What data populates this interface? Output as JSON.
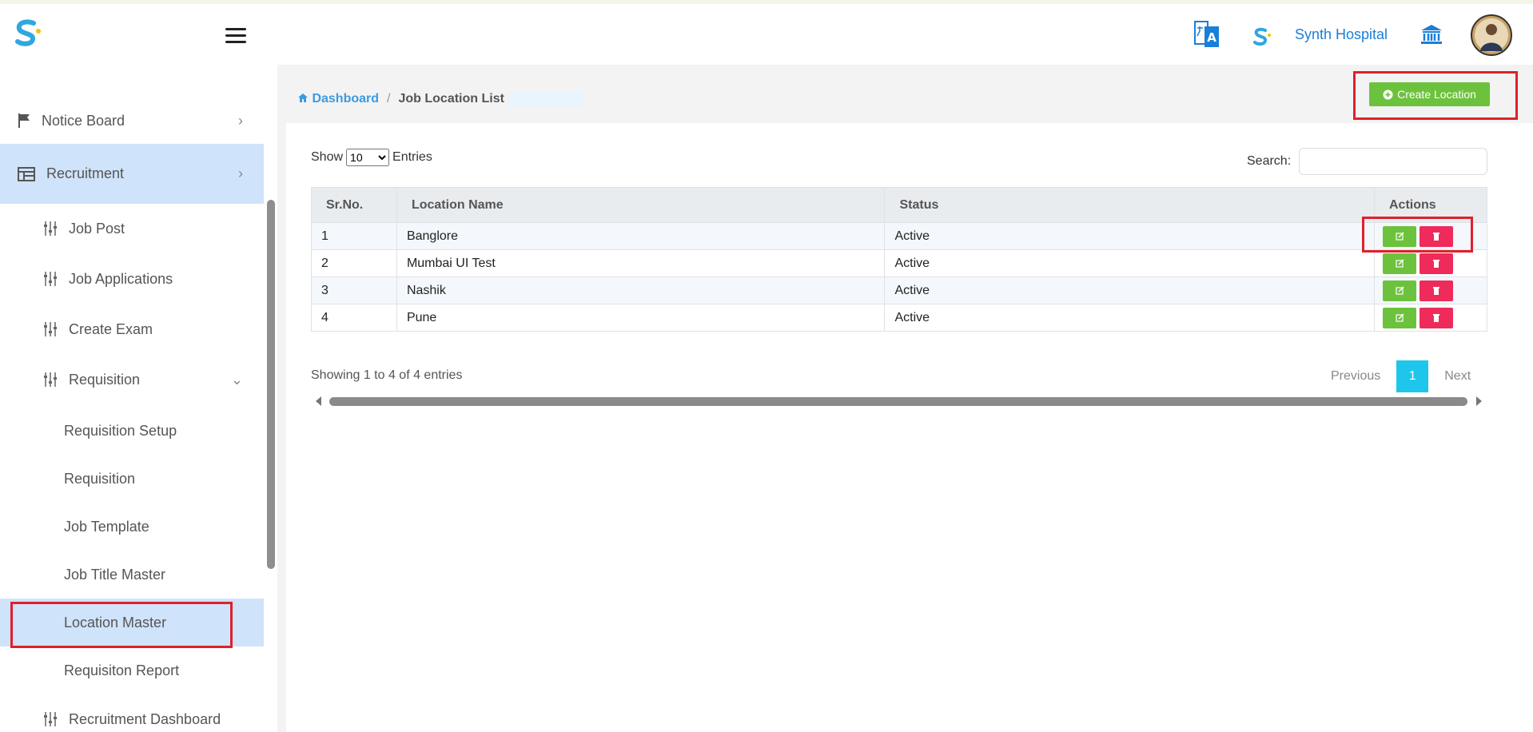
{
  "app": {
    "hospital_name": "Synth Hospital"
  },
  "sidebar": {
    "items": [
      {
        "label": "Notice Board"
      },
      {
        "label": "Recruitment"
      }
    ],
    "recruitment_items": [
      {
        "label": "Job Post"
      },
      {
        "label": "Job Applications"
      },
      {
        "label": "Create Exam"
      },
      {
        "label": "Requisition"
      }
    ],
    "requisition_items": [
      {
        "label": "Requisition Setup"
      },
      {
        "label": "Requisition"
      },
      {
        "label": "Job Template"
      },
      {
        "label": "Job Title Master"
      },
      {
        "label": "Location Master"
      },
      {
        "label": "Requisiton Report"
      }
    ],
    "recruitment_dashboard": "Recruitment Dashboard"
  },
  "breadcrumb": {
    "home": "Dashboard",
    "current": "Job Location List"
  },
  "toolbar": {
    "create_label": "Create Location"
  },
  "list": {
    "show_label": "Show",
    "entries_label": "Entries",
    "page_size": "10",
    "search_label": "Search:",
    "columns": [
      "Sr.No.",
      "Location Name",
      "Status",
      "Actions"
    ],
    "rows": [
      {
        "sr": "1",
        "name": "Banglore",
        "status": "Active"
      },
      {
        "sr": "2",
        "name": "Mumbai UI Test",
        "status": "Active"
      },
      {
        "sr": "3",
        "name": "Nashik",
        "status": "Active"
      },
      {
        "sr": "4",
        "name": "Pune",
        "status": "Active"
      }
    ],
    "info": "Showing 1 to 4 of 4 entries",
    "pager": {
      "prev": "Previous",
      "page": "1",
      "next": "Next"
    }
  },
  "colors": {
    "accent": "#1a7fd6",
    "success": "#6cc23c",
    "danger": "#ee2b5a",
    "active_bg": "#cfe3fa",
    "highlight": "#e0202a"
  }
}
